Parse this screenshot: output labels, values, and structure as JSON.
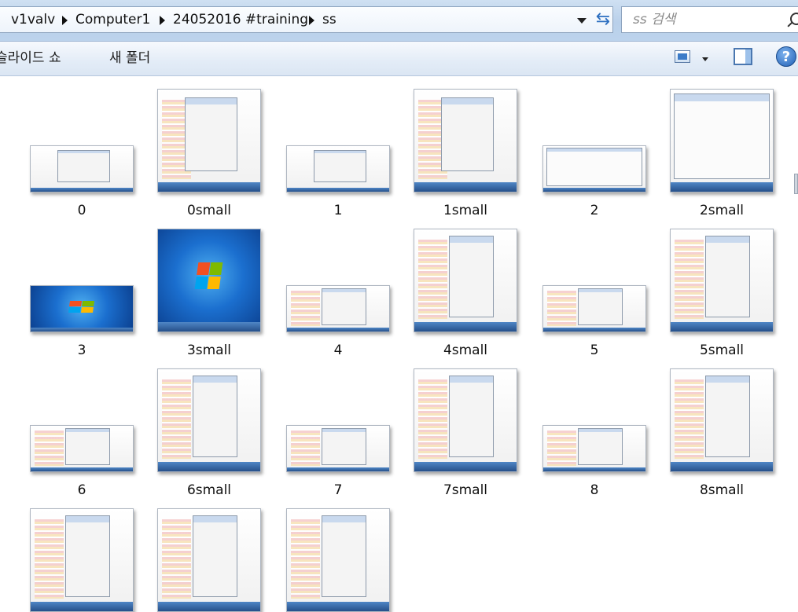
{
  "address_bar": {
    "crumbs": [
      "v1valv",
      "Computer1",
      "24052016 #training",
      "ss"
    ],
    "search_placeholder": "ss 검색"
  },
  "command_bar": {
    "slideshow_label": "슬라이드 쇼",
    "new_folder_label": "새 폴더",
    "help_label": "?"
  },
  "icons": {
    "refresh": "refresh-icon",
    "search": "search-icon",
    "view": "view-options-icon",
    "preview": "preview-pane-icon",
    "help": "help-icon"
  },
  "files": [
    {
      "name": "0",
      "kind": "dialog"
    },
    {
      "name": "0small",
      "kind": "dialog-list"
    },
    {
      "name": "1",
      "kind": "dialog"
    },
    {
      "name": "1small",
      "kind": "dialog-list"
    },
    {
      "name": "2",
      "kind": "settings"
    },
    {
      "name": "2small",
      "kind": "settings"
    },
    {
      "name": "3",
      "kind": "desktop"
    },
    {
      "name": "3small",
      "kind": "desktop"
    },
    {
      "name": "4",
      "kind": "spreadsheet"
    },
    {
      "name": "4small",
      "kind": "spreadsheet"
    },
    {
      "name": "5",
      "kind": "spreadsheet"
    },
    {
      "name": "5small",
      "kind": "spreadsheet"
    },
    {
      "name": "6",
      "kind": "spreadsheet"
    },
    {
      "name": "6small",
      "kind": "spreadsheet"
    },
    {
      "name": "7",
      "kind": "spreadsheet"
    },
    {
      "name": "7small",
      "kind": "spreadsheet"
    },
    {
      "name": "8",
      "kind": "spreadsheet"
    },
    {
      "name": "8small",
      "kind": "spreadsheet"
    },
    {
      "name": "",
      "kind": "spreadsheet"
    },
    {
      "name": "",
      "kind": "spreadsheet"
    },
    {
      "name": "",
      "kind": "spreadsheet"
    }
  ]
}
